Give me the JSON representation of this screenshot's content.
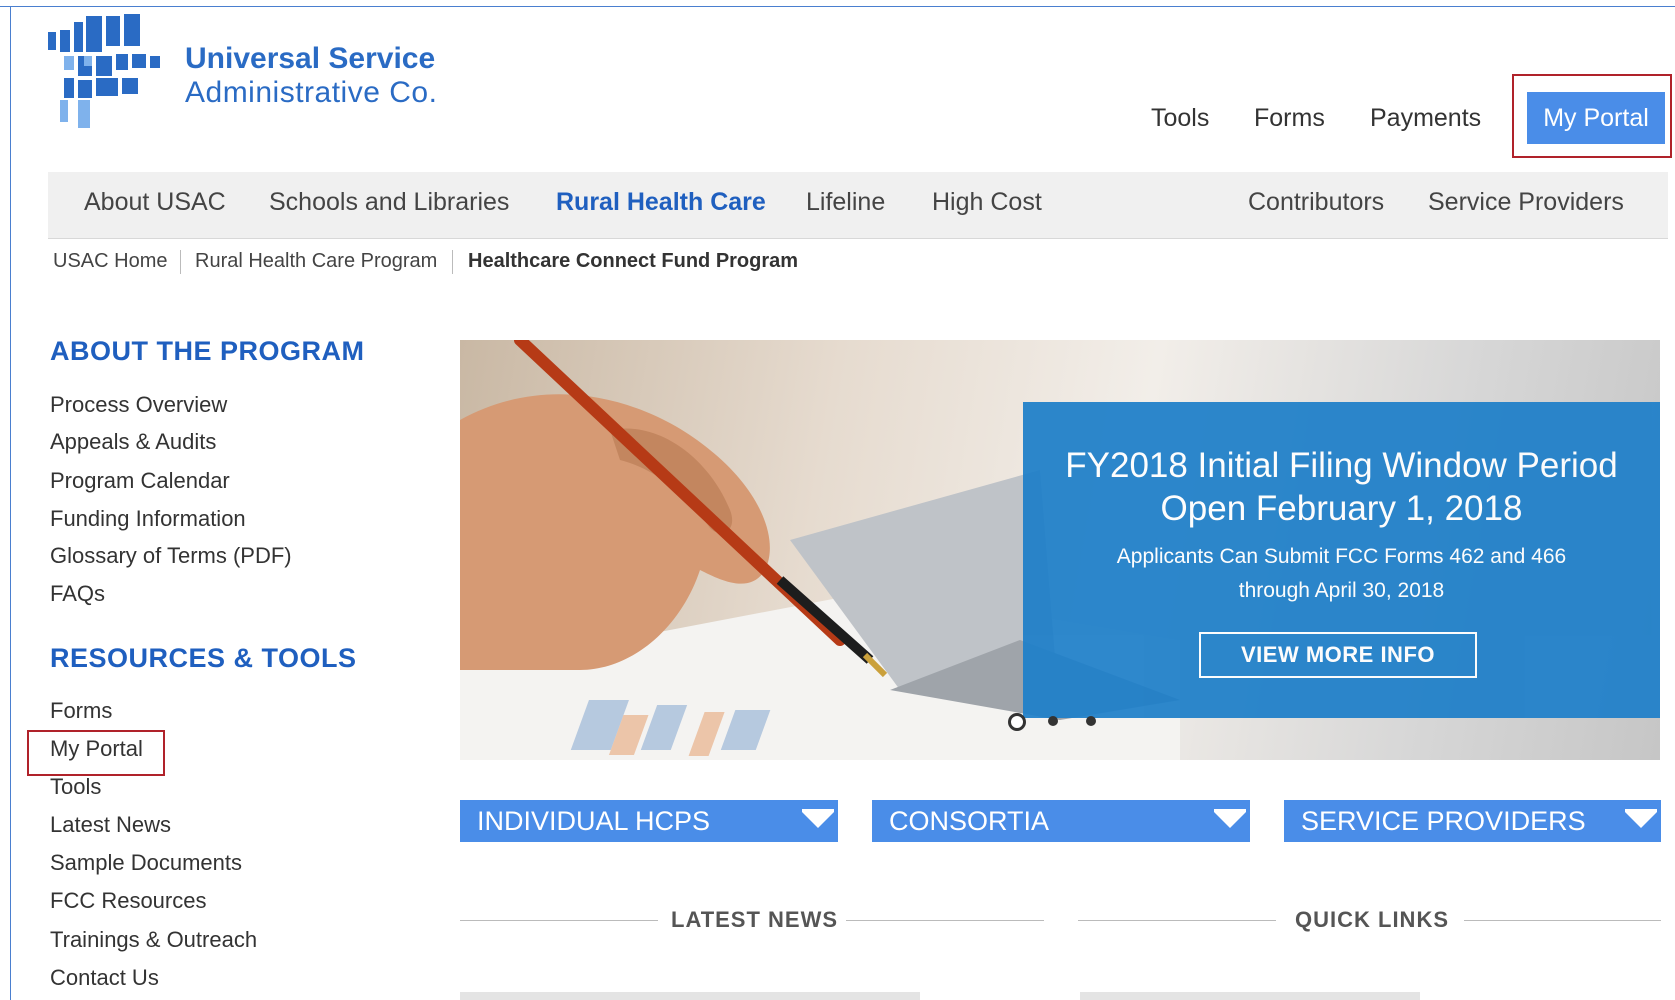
{
  "logo": {
    "line1": "Universal Service",
    "line2": "Administrative Co."
  },
  "utility_nav": {
    "tools": "Tools",
    "forms": "Forms",
    "payments": "Payments",
    "my_portal": "My Portal"
  },
  "main_nav": {
    "about": "About USAC",
    "schools": "Schools and Libraries",
    "rural": "Rural Health Care",
    "lifeline": "Lifeline",
    "high_cost": "High Cost",
    "contributors": "Contributors",
    "service_providers": "Service Providers"
  },
  "breadcrumb": {
    "home": "USAC Home",
    "program": "Rural Health Care Program",
    "current": "Healthcare Connect Fund Program"
  },
  "sidebar": {
    "about_heading": "ABOUT THE PROGRAM",
    "about_links": [
      "Process Overview",
      "Appeals & Audits",
      "Program Calendar",
      "Funding Information",
      "Glossary of Terms (PDF)",
      "FAQs"
    ],
    "resources_heading": "RESOURCES & TOOLS",
    "resources_links": [
      "Forms",
      "My Portal",
      "Tools",
      "Latest News",
      "Sample Documents",
      "FCC Resources",
      "Trainings & Outreach",
      "Contact Us"
    ]
  },
  "hero": {
    "title1": "FY2018 Initial Filing Window Period",
    "title2": "Open February 1, 2018",
    "sub1": "Applicants Can Submit FCC Forms 462 and 466",
    "sub2": "through April 30, 2018",
    "button": "VIEW MORE INFO"
  },
  "dropdowns": {
    "individual": "INDIVIDUAL HCPS",
    "consortia": "CONSORTIA",
    "providers": "SERVICE PROVIDERS"
  },
  "sections": {
    "news": "LATEST NEWS",
    "links": "QUICK LINKS"
  },
  "colors": {
    "brand_blue": "#2a6bc4",
    "button_blue": "#4a8de8",
    "hero_panel": "#1e7fc9",
    "highlight_red": "#b0222a"
  }
}
